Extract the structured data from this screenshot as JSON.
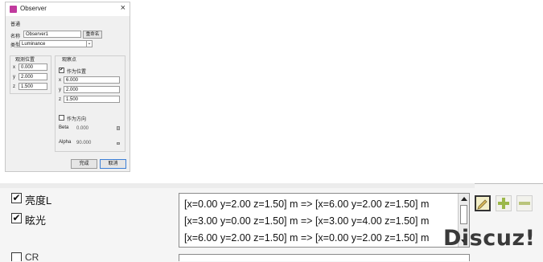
{
  "dialog": {
    "title": "Observer",
    "close_glyph": "×",
    "general_section": "普通",
    "name_label": "名称",
    "name_value": "Observer1",
    "rename_button": "重命名",
    "type_label": "类型",
    "type_value": "Luminance",
    "dropdown_glyph": "⌄",
    "observer_position_group": "观测位置",
    "pos_x_label": "x",
    "pos_x_value": "0.000",
    "pos_y_label": "y",
    "pos_y_value": "2.000",
    "pos_z_label": "z",
    "pos_z_value": "1.500",
    "target_group": "观察点",
    "as_position_check": "✔",
    "as_position_label": "作为位置",
    "tgt_x_label": "x",
    "tgt_x_value": "6.000",
    "tgt_y_label": "y",
    "tgt_y_value": "2.000",
    "tgt_z_label": "z",
    "tgt_z_value": "1.500",
    "as_direction_label": "作为方向",
    "beta_label": "Beta",
    "beta_value": "0.000",
    "alpha_label": "Alpha",
    "alpha_value": "90.000",
    "ok_button": "完成",
    "cancel_button": "取消"
  },
  "options": {
    "brightness": {
      "checked": true,
      "check_glyph": "✔",
      "label": "亮度L"
    },
    "glare": {
      "checked": true,
      "check_glyph": "✔",
      "label": "眩光"
    },
    "partial_label": "CR"
  },
  "observer_list": {
    "rows": [
      "[x=0.00 y=2.00 z=1.50] m => [x=6.00 y=2.00 z=1.50] m",
      "[x=3.00 y=0.00 z=1.50] m => [x=3.00 y=4.00 z=1.50] m",
      "[x=6.00 y=2.00 z=1.50] m => [x=0.00 y=2.00 z=1.50] m"
    ]
  },
  "tools": {
    "edit_icon": "pencil-icon",
    "add_icon": "plus-icon",
    "remove_icon": "minus-icon",
    "add_color": "#9bb84a",
    "remove_color": "#b9c47a"
  },
  "watermark": "Discuz!"
}
